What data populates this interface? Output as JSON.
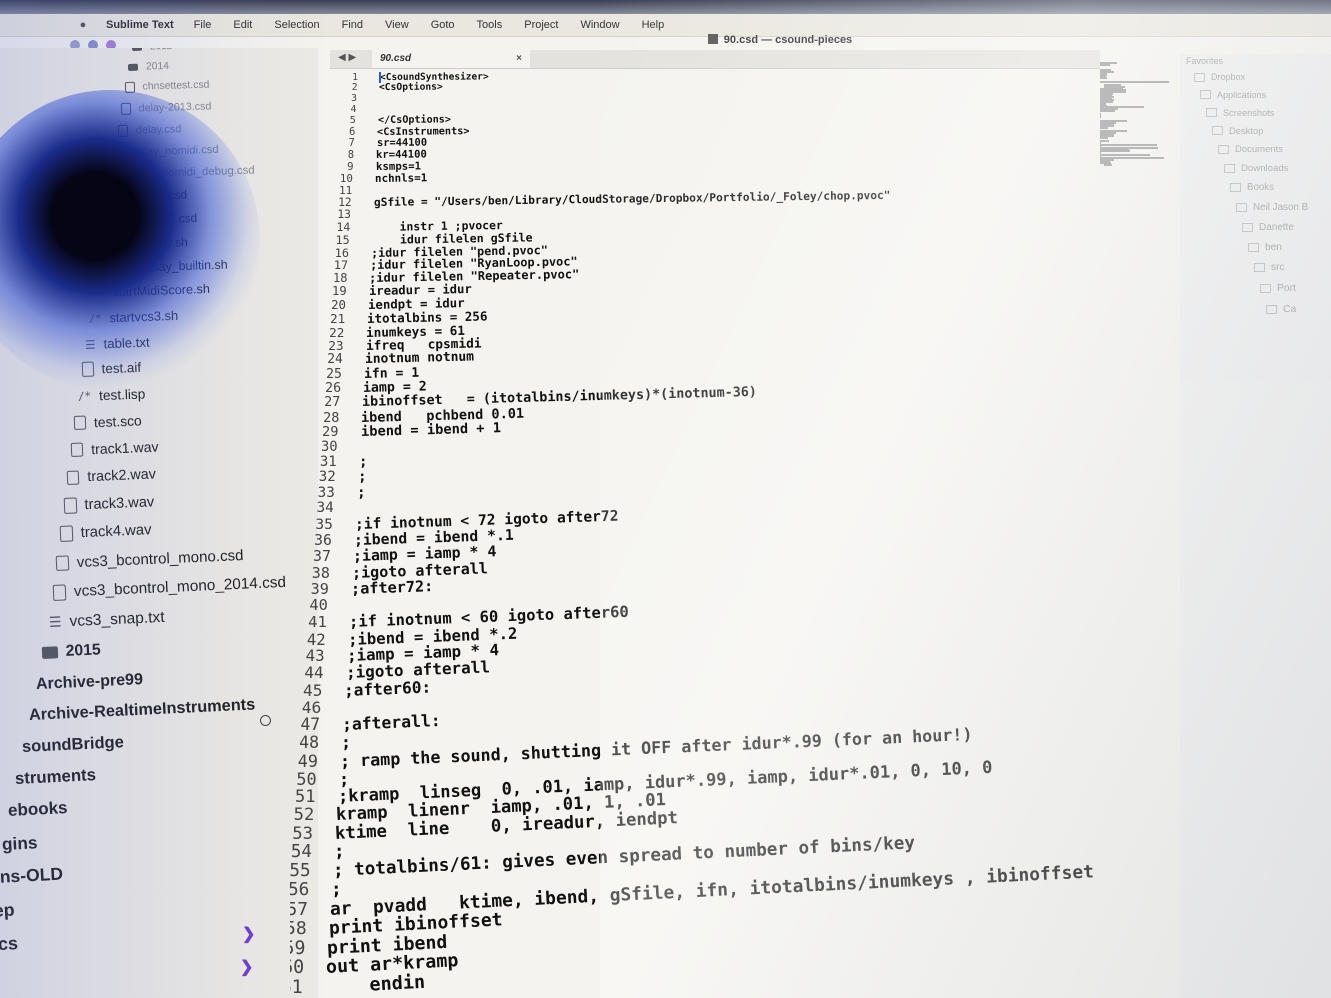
{
  "menubar": {
    "app": "Sublime Text",
    "items": [
      "File",
      "Edit",
      "Selection",
      "Find",
      "View",
      "Goto",
      "Tools",
      "Project",
      "Window",
      "Help"
    ]
  },
  "window": {
    "title": "90.csd — csound-pieces"
  },
  "sidebar": {
    "items": [
      {
        "label": "2012",
        "kind": "folder"
      },
      {
        "label": "2014",
        "kind": "folder"
      },
      {
        "label": "chnsettest.csd",
        "kind": "file"
      },
      {
        "label": "delay-2013.csd",
        "kind": "file"
      },
      {
        "label": "delay.csd",
        "kind": "file"
      },
      {
        "label": "delay_nomidi.csd",
        "kind": "file"
      },
      {
        "label": "delay_nomidi_debug.csd",
        "kind": "file"
      },
      {
        "label": "miditest.csd",
        "kind": "file"
      },
      {
        "label": "pvocsynth.csd",
        "kind": "file"
      },
      {
        "label": "startdelay.sh",
        "kind": "script"
      },
      {
        "label": "startDelay_builtin.sh",
        "kind": "script"
      },
      {
        "label": "startMidiScore.sh",
        "kind": "script"
      },
      {
        "label": "startvcs3.sh",
        "kind": "script"
      },
      {
        "label": "table.txt",
        "kind": "text"
      },
      {
        "label": "test.aif",
        "kind": "file"
      },
      {
        "label": "test.lisp",
        "kind": "script"
      },
      {
        "label": "test.sco",
        "kind": "file"
      },
      {
        "label": "track1.wav",
        "kind": "file"
      },
      {
        "label": "track2.wav",
        "kind": "file"
      },
      {
        "label": "track3.wav",
        "kind": "file"
      },
      {
        "label": "track4.wav",
        "kind": "file"
      },
      {
        "label": "vcs3_bcontrol_mono.csd",
        "kind": "file"
      },
      {
        "label": "vcs3_bcontrol_mono_2014.csd",
        "kind": "file"
      },
      {
        "label": "vcs3_snap.txt",
        "kind": "text"
      },
      {
        "label": "2015",
        "kind": "folder"
      },
      {
        "label": "Archive-pre99",
        "kind": "folder"
      },
      {
        "label": "Archive-RealtimeInstruments",
        "kind": "folder"
      },
      {
        "label": "soundBridge",
        "kind": "folder"
      },
      {
        "label": "struments",
        "kind": "folder"
      },
      {
        "label": "ebooks",
        "kind": "folder"
      },
      {
        "label": "gins",
        "kind": "folder"
      },
      {
        "label": "ins-OLD",
        "kind": "folder"
      },
      {
        "label": "-ep",
        "kind": "folder"
      },
      {
        "label": "n-cs",
        "kind": "folder"
      }
    ]
  },
  "tab": {
    "label": "90.csd",
    "close": "×",
    "nav": "◀ ▶"
  },
  "editor": {
    "lines": [
      {
        "n": "1",
        "t": "<CsoundSynthesizer>"
      },
      {
        "n": "2",
        "t": "<CsOptions>"
      },
      {
        "n": "3",
        "t": ""
      },
      {
        "n": "4",
        "t": ""
      },
      {
        "n": "5",
        "t": "</CsOptions>"
      },
      {
        "n": "6",
        "t": "<CsInstruments>"
      },
      {
        "n": "7",
        "t": "sr=44100"
      },
      {
        "n": "8",
        "t": "kr=44100"
      },
      {
        "n": "9",
        "t": "ksmps=1"
      },
      {
        "n": "10",
        "t": "nchnls=1"
      },
      {
        "n": "11",
        "t": ""
      },
      {
        "n": "12",
        "t": "gSfile = \"/Users/ben/Library/CloudStorage/Dropbox/Portfolio/_Foley/chop.pvoc\""
      },
      {
        "n": "13",
        "t": ""
      },
      {
        "n": "14",
        "t": "    instr 1 ;pvocer"
      },
      {
        "n": "15",
        "t": "    idur filelen gSfile"
      },
      {
        "n": "16",
        "t": ";idur filelen \"pend.pvoc\""
      },
      {
        "n": "17",
        "t": ";idur filelen \"RyanLoop.pvoc\""
      },
      {
        "n": "18",
        "t": ";idur filelen \"Repeater.pvoc\""
      },
      {
        "n": "19",
        "t": "ireadur = idur"
      },
      {
        "n": "20",
        "t": "iendpt = idur"
      },
      {
        "n": "21",
        "t": "itotalbins = 256"
      },
      {
        "n": "22",
        "t": "inumkeys = 61"
      },
      {
        "n": "23",
        "t": "ifreq   cpsmidi"
      },
      {
        "n": "24",
        "t": "inotnum notnum"
      },
      {
        "n": "25",
        "t": "ifn = 1"
      },
      {
        "n": "26",
        "t": "iamp = 2"
      },
      {
        "n": "27",
        "t": "ibinoffset   = (itotalbins/inumkeys)*(inotnum-36)"
      },
      {
        "n": "28",
        "t": "ibend   pchbend 0.01"
      },
      {
        "n": "29",
        "t": "ibend = ibend + 1"
      },
      {
        "n": "30",
        "t": ""
      },
      {
        "n": "31",
        "t": ";"
      },
      {
        "n": "32",
        "t": ";"
      },
      {
        "n": "33",
        "t": ";"
      },
      {
        "n": "34",
        "t": ""
      },
      {
        "n": "35",
        "t": ";if inotnum < 72 igoto after72"
      },
      {
        "n": "36",
        "t": ";ibend = ibend *.1"
      },
      {
        "n": "37",
        "t": ";iamp = iamp * 4"
      },
      {
        "n": "38",
        "t": ";igoto afterall"
      },
      {
        "n": "39",
        "t": ";after72:"
      },
      {
        "n": "40",
        "t": ""
      },
      {
        "n": "41",
        "t": ";if inotnum < 60 igoto after60"
      },
      {
        "n": "42",
        "t": ";ibend = ibend *.2"
      },
      {
        "n": "43",
        "t": ";iamp = iamp * 4"
      },
      {
        "n": "44",
        "t": ";igoto afterall"
      },
      {
        "n": "45",
        "t": ";after60:"
      },
      {
        "n": "46",
        "t": ""
      },
      {
        "n": "47",
        "t": ";afterall:"
      },
      {
        "n": "48",
        "t": ";"
      },
      {
        "n": "49",
        "t": "; ramp the sound, shutting it OFF after idur*.99 (for an hour!)"
      },
      {
        "n": "50",
        "t": ";"
      },
      {
        "n": "51",
        "t": ";kramp  linseg  0, .01, iamp, idur*.99, iamp, idur*.01, 0, 10, 0"
      },
      {
        "n": "52",
        "t": "kramp  linenr  iamp, .01, 1, .01"
      },
      {
        "n": "53",
        "t": "ktime  line    0, ireadur, iendpt"
      },
      {
        "n": "54",
        "t": ";"
      },
      {
        "n": "55",
        "t": "; totalbins/61: gives even spread to number of bins/key"
      },
      {
        "n": "56",
        "t": ";"
      },
      {
        "n": "57",
        "t": "ar  pvadd   ktime, ibend, gSfile, ifn, itotalbins/inumkeys , ibinoffset"
      },
      {
        "n": "58",
        "t": "print ibinoffset"
      },
      {
        "n": "59",
        "t": "print ibend"
      },
      {
        "n": "60",
        "t": "out ar*kramp"
      },
      {
        "n": "61",
        "t": "    endin"
      }
    ]
  },
  "finder": {
    "header": "Favorites",
    "items": [
      "Dropbox",
      "Applications",
      "Screenshots",
      "Desktop",
      "Documents",
      "Downloads",
      "Books",
      "Neil Jason B",
      "Danette",
      "ben",
      "src",
      "Port",
      "Ca"
    ]
  }
}
